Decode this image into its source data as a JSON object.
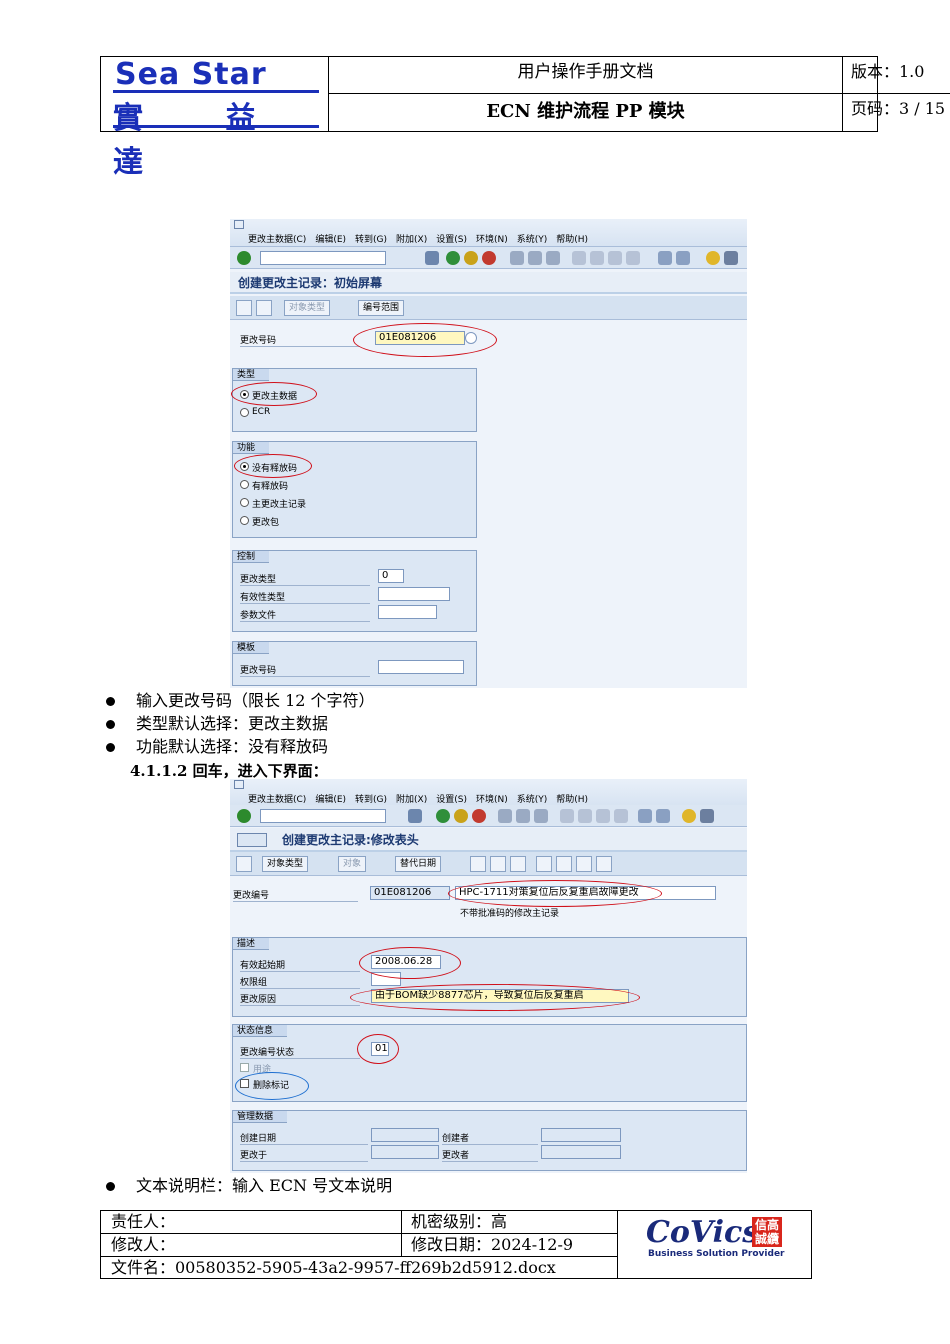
{
  "header": {
    "logo_en": "Sea Star",
    "logo_cn": "實 益 達",
    "doc_type": "用户操作手册文档",
    "doc_title": "ECN 维护流程 PP 模块",
    "version": "版本：1.0",
    "page": "页码：3 / 15"
  },
  "screen1": {
    "menu": [
      "更改主数据(C)",
      "编辑(E)",
      "转到(G)",
      "附加(X)",
      "设置(S)",
      "环境(N)",
      "系统(Y)",
      "帮助(H)"
    ],
    "title": "创建更改主记录：初始屏幕",
    "buttons": [
      "对象类型",
      "编号范围"
    ],
    "change_no_label": "更改号码",
    "change_no_value": "01E081206",
    "type_group": {
      "title": "类型",
      "options": [
        "更改主数据",
        "ECR"
      ],
      "selected": "更改主数据"
    },
    "func_group": {
      "title": "功能",
      "options": [
        "没有释放码",
        "有释放码",
        "主更改主记录",
        "更改包"
      ],
      "selected": "没有释放码"
    },
    "control_group": {
      "title": "控制",
      "fields": [
        {
          "label": "更改类型",
          "value": "0"
        },
        {
          "label": "有效性类型",
          "value": ""
        },
        {
          "label": "参数文件",
          "value": ""
        }
      ]
    },
    "template_group": {
      "title": "模板",
      "label": "更改号码",
      "value": ""
    }
  },
  "bullets1": [
    "输入更改号码（限长 12 个字符）",
    "类型默认选择：更改主数据",
    "功能默认选择：没有释放码"
  ],
  "subheading": "4.1.1.2 回车，进入下界面：",
  "screen2": {
    "menu": [
      "更改主数据(C)",
      "编辑(E)",
      "转到(G)",
      "附加(X)",
      "设置(S)",
      "环境(N)",
      "系统(Y)",
      "帮助(H)"
    ],
    "title": "创建更改主记录:修改表头",
    "buttons": [
      "对象类型",
      "对象",
      "替代日期"
    ],
    "change_no_label": "更改编号",
    "change_no_value": "01E081206",
    "description_value": "HPC-1711对策复位后反复重启故障更改",
    "note": "不带批准码的修改主记录",
    "desc_group": {
      "title": "描述",
      "valid_from_label": "有效起始期",
      "valid_from_value": "2008.06.28",
      "auth_group_label": "权限组",
      "reason_label": "更改原因",
      "reason_value": "由于BOM缺少8877芯片，导致复位后反复重启"
    },
    "status_group": {
      "title": "状态信息",
      "status_label": "更改编号状态",
      "status_value": "01",
      "use_label": "用途",
      "delete_label": "删除标记"
    },
    "admin_group": {
      "title": "管理数据",
      "created_on": "创建日期",
      "created_by": "创建者",
      "changed_on": "更改于",
      "changed_by": "更改者"
    }
  },
  "bullets2": [
    "文本说明栏：输入 ECN 号文本说明"
  ],
  "footer": {
    "responsible": "责任人：",
    "secrecy": "机密级别：高",
    "modifier": "修改人：",
    "modified_date": "修改日期：2024-12-9",
    "filename": "文件名：00580352-5905-43a2-9957-ff269b2d5912.docx",
    "covics": "CoVics",
    "covics_cn1": "信高",
    "covics_cn2": "誠纜",
    "covics_tagline": "Business Solution Provider"
  }
}
